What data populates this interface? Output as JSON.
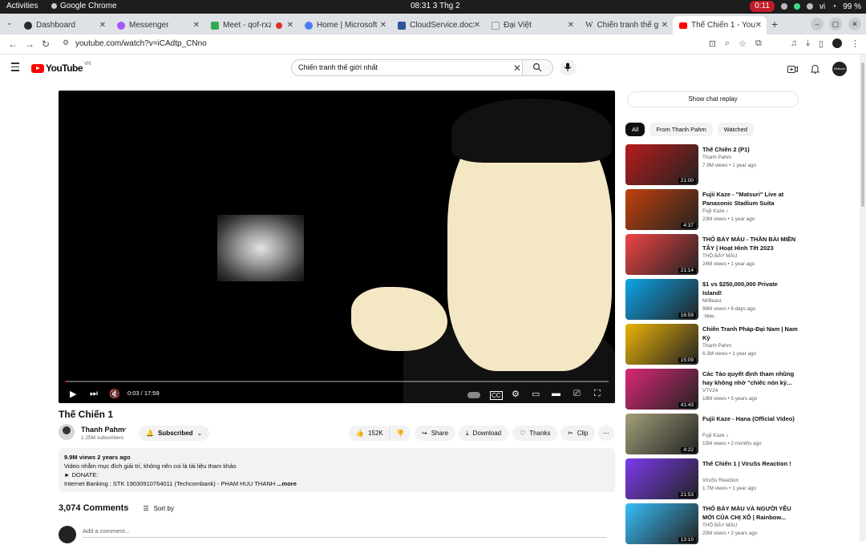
{
  "os": {
    "activities": "Activities",
    "app": "Google Chrome",
    "clock": "08:31  3 Thg 2",
    "recording": "0:11",
    "lang": "vi",
    "battery": "99 %"
  },
  "tabs": [
    {
      "label": "Dashboard",
      "color": "#24292f"
    },
    {
      "label": "Messenger",
      "color": "#a855f7"
    },
    {
      "label": "Meet - qof-rxzi",
      "color": "#34a853"
    },
    {
      "label": "Home | Microsoft",
      "color": "#4f7cf5"
    },
    {
      "label": "CloudService.docx",
      "color": "#2b579a"
    },
    {
      "label": "Đại Việt",
      "color": "#777777"
    },
    {
      "label": "Chiến tranh thế g",
      "color": "#666666"
    },
    {
      "label": "Thế Chiến 1 - You",
      "color": "#ff0000"
    }
  ],
  "address": {
    "url": "youtube.com/watch?v=iCAdtp_CNno"
  },
  "yt": {
    "logo": "YouTube",
    "region": "VN",
    "search_value": "Chiến tranh thế giới nhất",
    "account": "Hellcore"
  },
  "player": {
    "time": "0:03 / 17:59",
    "progress": 0.003
  },
  "video": {
    "title": "Thế Chiến 1",
    "channel": "Thanh Pahm",
    "subs": "1.25M subscribers",
    "subscribed": "Subscribed",
    "likes": "152K",
    "share": "Share",
    "download": "Download",
    "thanks": "Thanks",
    "clip": "Clip"
  },
  "description": {
    "meta": "9.9M views  2 years ago",
    "line1": "Video nhằm mục đích giải trí, không nên coi là tài liệu tham khảo",
    "line2": "► DONATE:",
    "line3": "Internet Banking : STK 19030910764011 (Techcombank)  - PHAM HUU THANH",
    "more": "...more"
  },
  "comments": {
    "count": "3,074 Comments",
    "sort": "Sort by",
    "placeholder": "Add a comment..."
  },
  "sidebar": {
    "chat_replay": "Show chat replay",
    "chips": [
      "All",
      "From Thanh Pahm",
      "Watched"
    ],
    "recs": [
      {
        "title": "Thế Chiến 2 (P1)",
        "channel": "Thanh Pahm",
        "stats": "7.9M views  •  1 year ago",
        "duration": "21:00",
        "badge": "",
        "thumb": "#b71c1c"
      },
      {
        "title": "Fujii Kaze - \"Matsuri\" Live at Panasonic Stadium Suita",
        "channel": "Fujii Kaze ♪",
        "stats": "23M views  •  1 year ago",
        "duration": "4:37",
        "badge": "",
        "thumb": "#c2410c"
      },
      {
        "title": "THỎ BẢY MÀU - THẦN BÀI MIỀN TÂY | Hoạt Hình Tết 2023",
        "channel": "THỎ BẢY MÀU",
        "stats": "24M views  •  1 year ago",
        "duration": "21:14",
        "badge": "",
        "thumb": "#ef4444"
      },
      {
        "title": "$1 vs $250,000,000 Private Island!",
        "channel": "MrBeast",
        "stats": "98M views  •  6 days ago",
        "duration": "16:59",
        "badge": "New",
        "thumb": "#0ea5e9"
      },
      {
        "title": "Chiến Tranh Pháp-Đại Nam | Nam Kỳ",
        "channel": "Thanh Pahm",
        "stats": "6.3M views  •  1 year ago",
        "duration": "15:09",
        "badge": "",
        "thumb": "#eab308"
      },
      {
        "title": "Các Táo quyết định tham nhũng hay không nhờ \"chiếc nón kỳ...",
        "channel": "VTV24",
        "stats": "18M views  •  5 years ago",
        "duration": "41:43",
        "badge": "",
        "thumb": "#db2777"
      },
      {
        "title": "Fujii Kaze - Hana (Official Video)",
        "channel": "Fujii Kaze ♪",
        "stats": "15M views  •  2 months ago",
        "duration": "4:22",
        "badge": "",
        "thumb": "#a3a07a"
      },
      {
        "title": "Thế Chiến 1 | ViruSs Reaction !",
        "channel": "ViruSs Reaction",
        "stats": "1.7M views  •  1 year ago",
        "duration": "21:53",
        "badge": "",
        "thumb": "#7c3aed"
      },
      {
        "title": "THỎ BẢY MÀU VÀ NGƯỜI YÊU MỚI CỦA CHỊ XÔ | Rainbow...",
        "channel": "THỎ BẢY MÀU",
        "stats": "25M views  •  2 years ago",
        "duration": "13:10",
        "badge": "",
        "thumb": "#38bdf8"
      }
    ]
  }
}
